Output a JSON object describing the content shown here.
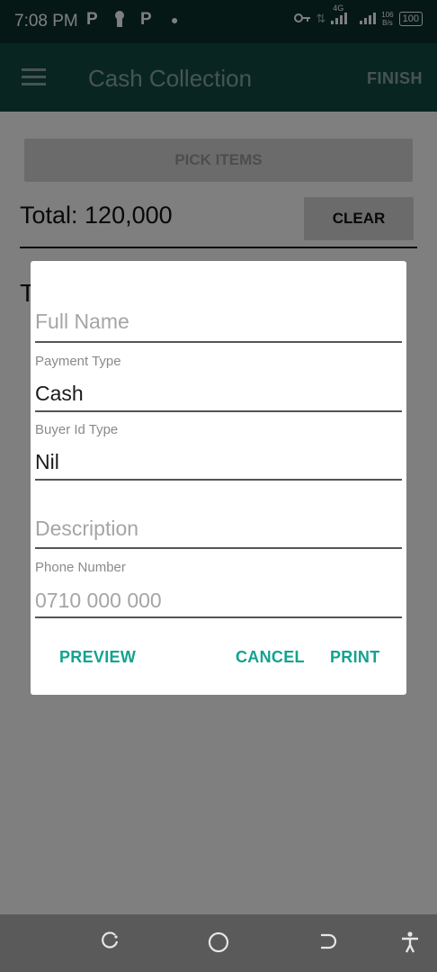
{
  "status_bar": {
    "time": "7:08 PM",
    "icons": [
      "parking-icon",
      "keyhole-icon",
      "parking-icon"
    ],
    "network": "4G",
    "speed_value": "106",
    "speed_unit": "B/s",
    "battery": "100"
  },
  "app_bar": {
    "title": "Cash Collection",
    "finish_label": "FINISH"
  },
  "main": {
    "pick_items_label": "PICK ITEMS",
    "total_text": "Total: 120,000",
    "clear_label": "CLEAR",
    "partial_text": "T"
  },
  "dialog": {
    "full_name": {
      "placeholder": "Full Name"
    },
    "payment_type": {
      "label": "Payment Type",
      "value": "Cash"
    },
    "buyer_id_type": {
      "label": "Buyer Id Type",
      "value": "Nil"
    },
    "description": {
      "placeholder": "Description"
    },
    "phone_number": {
      "label": "Phone Number",
      "placeholder": "0710 000 000"
    },
    "actions": {
      "preview": "PREVIEW",
      "cancel": "CANCEL",
      "print": "PRINT"
    }
  },
  "nav_bar": {
    "icons": [
      "recents-icon",
      "home-icon",
      "back-icon",
      "accessibility-icon"
    ]
  },
  "colors": {
    "status_bar": "#0a302b",
    "app_bar": "#134b45",
    "accent": "#12a38f"
  }
}
